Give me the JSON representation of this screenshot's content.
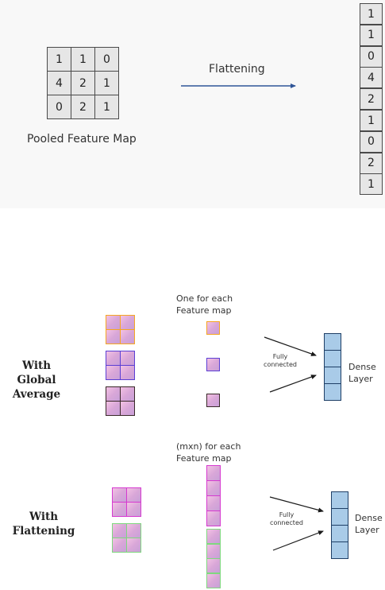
{
  "top": {
    "grid_values": [
      [
        1,
        1,
        0
      ],
      [
        4,
        2,
        1
      ],
      [
        0,
        2,
        1
      ]
    ],
    "grid_label": "Pooled Feature Map",
    "arrow_label": "Flattening",
    "flat_values": [
      1,
      1,
      0,
      4,
      2,
      1,
      0,
      2,
      1
    ]
  },
  "bottom": {
    "gap_row_label": [
      "With Global",
      "Average"
    ],
    "gap_column_label": [
      "One for each",
      "Feature map"
    ],
    "flat_row_label": [
      "With",
      "Flattening"
    ],
    "flat_column_label": [
      "(mxn) for each",
      "Feature map"
    ],
    "fc_label": [
      "Fully",
      "connected"
    ],
    "dense_label": [
      "Dense",
      "Layer"
    ],
    "colors": {
      "orange_border": "#f5a623",
      "purple_border": "#5b3fd4",
      "dark_border": "#3a2a2a",
      "pink_border": "#d63ad0",
      "green_border": "#7fd87f",
      "dense_fill": "#a9cbe8",
      "dense_border": "#1f3f66"
    }
  }
}
